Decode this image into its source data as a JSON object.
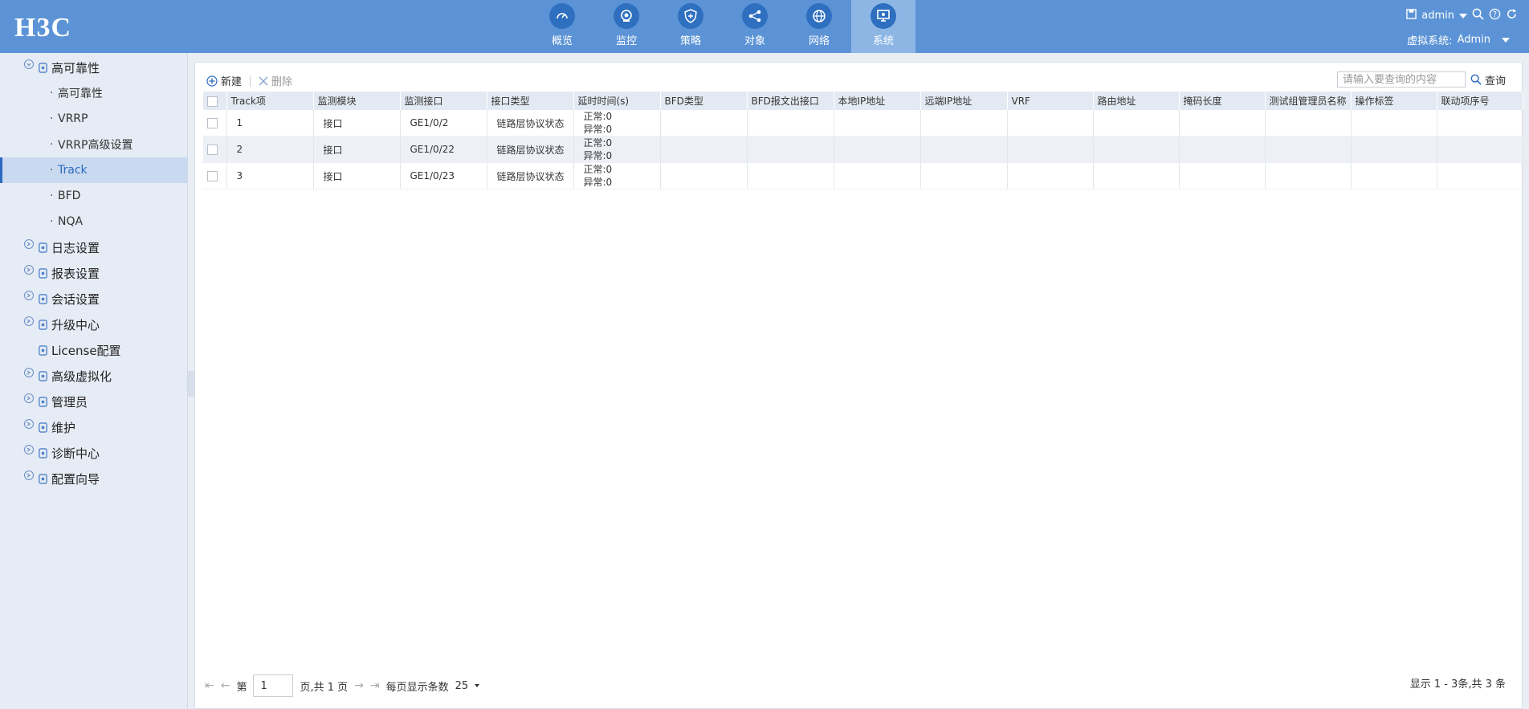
{
  "header": {
    "logo": "H3C",
    "nav": [
      {
        "label": "概览",
        "icon": "gauge-icon"
      },
      {
        "label": "监控",
        "icon": "camera-icon"
      },
      {
        "label": "策略",
        "icon": "shield-icon"
      },
      {
        "label": "对象",
        "icon": "share-icon"
      },
      {
        "label": "网络",
        "icon": "globe-icon"
      },
      {
        "label": "系统",
        "icon": "monitor-icon",
        "active": true
      }
    ],
    "user": "admin",
    "virtual_system_label": "虚拟系统:",
    "virtual_system_value": "Admin"
  },
  "sidebar": {
    "items": [
      {
        "type": "group",
        "label": "高可靠性",
        "icon": "shield-icon"
      },
      {
        "type": "sub",
        "label": "高可靠性"
      },
      {
        "type": "sub",
        "label": "VRRP"
      },
      {
        "type": "sub",
        "label": "VRRP高级设置"
      },
      {
        "type": "sub",
        "label": "Track",
        "active": true
      },
      {
        "type": "sub",
        "label": "BFD"
      },
      {
        "type": "sub",
        "label": "NQA"
      },
      {
        "type": "group",
        "label": "日志设置",
        "icon": "log-icon"
      },
      {
        "type": "group",
        "label": "报表设置",
        "icon": "report-icon"
      },
      {
        "type": "group",
        "label": "会话设置",
        "icon": "session-icon"
      },
      {
        "type": "group",
        "label": "升级中心",
        "icon": "upload-icon"
      },
      {
        "type": "group",
        "label": "License配置",
        "icon": "license-icon",
        "noexpand": true
      },
      {
        "type": "group",
        "label": "高级虚拟化",
        "icon": "virtual-icon"
      },
      {
        "type": "group",
        "label": "管理员",
        "icon": "admin-icon"
      },
      {
        "type": "group",
        "label": "维护",
        "icon": "tools-icon"
      },
      {
        "type": "group",
        "label": "诊断中心",
        "icon": "diagnose-icon"
      },
      {
        "type": "group",
        "label": "配置向导",
        "icon": "wizard-icon"
      }
    ]
  },
  "toolbar": {
    "new_label": "新建",
    "delete_label": "删除",
    "search_placeholder": "请输入要查询的内容",
    "search_label": "查询"
  },
  "table": {
    "columns": [
      "Track项",
      "监测模块",
      "监测接口",
      "接口类型",
      "延时时间(s)",
      "BFD类型",
      "BFD报文出接口",
      "本地IP地址",
      "远端IP地址",
      "VRF",
      "路由地址",
      "掩码长度",
      "测试组管理员名称",
      "操作标签",
      "联动项序号"
    ],
    "rows": [
      {
        "track": "1",
        "module": "接口",
        "iface": "GE1/0/2",
        "itype": "链路层协议状态",
        "delay_normal": "正常:0",
        "delay_abnormal": "异常:0"
      },
      {
        "track": "2",
        "module": "接口",
        "iface": "GE1/0/22",
        "itype": "链路层协议状态",
        "delay_normal": "正常:0",
        "delay_abnormal": "异常:0"
      },
      {
        "track": "3",
        "module": "接口",
        "iface": "GE1/0/23",
        "itype": "链路层协议状态",
        "delay_normal": "正常:0",
        "delay_abnormal": "异常:0"
      }
    ]
  },
  "pager": {
    "page_prefix": "第",
    "page_value": "1",
    "page_suffix": "页,共 1 页",
    "per_page_label": "每页显示条数",
    "per_page_value": "25",
    "info": "显示 1 - 3条,共 3 条"
  }
}
